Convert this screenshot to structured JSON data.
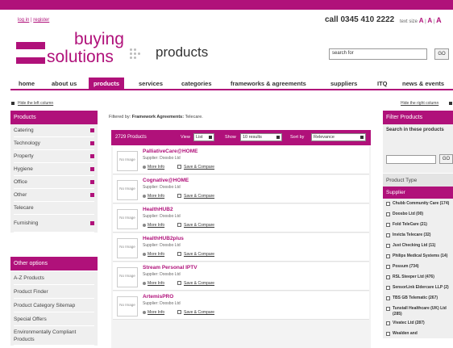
{
  "header": {
    "login_link": "log in",
    "register_link": "register",
    "call": "call 0345 410 2222",
    "text_size_label": "text size",
    "text_size_options": [
      "A",
      "A",
      "A"
    ],
    "logo_line1": "buying",
    "logo_line2": "solutions",
    "section_title": "products",
    "search_value": "search for",
    "search_button": "GO"
  },
  "nav": {
    "items": [
      "home",
      "about us",
      "products",
      "services",
      "categories",
      "frameworks & agreements",
      "suppliers",
      "ITQ",
      "news & events"
    ],
    "active": "products"
  },
  "hide_left_label": "Hide the left column",
  "hide_right_label": "Hide the right column",
  "left": {
    "products_title": "Products",
    "categories": [
      "Catering",
      "Technology",
      "Property",
      "Hygiene",
      "Office",
      "Other",
      "Telecare",
      "Furnishing"
    ],
    "other_options_title": "Other options",
    "other_options": [
      "A-Z Products",
      "Product Finder",
      "Product Category Sitemap",
      "Special Offers",
      "Environmentally Compliant Products"
    ]
  },
  "filter": {
    "prefix": "Filtered by:",
    "label": "Framework Agreements:",
    "value": "Telecare."
  },
  "results_header": {
    "count": "2729 Products",
    "view_label": "View",
    "view_value": "List",
    "show_label": "Show",
    "show_value": "10 results",
    "sort_label": "Sort by",
    "sort_value": "Relevance"
  },
  "no_image_text": "No Image",
  "more_info_label": "More Info",
  "save_compare_label": "Save & Compare",
  "products": [
    {
      "name": "PalliativeCare@HOME",
      "supplier": "Supplier: Doosbo Ltd"
    },
    {
      "name": "Cognative@HOME",
      "supplier": "Supplier: Doosbo Ltd"
    },
    {
      "name": "HealthHUB2",
      "supplier": "Supplier: Doosbo Ltd"
    },
    {
      "name": "HealthHUB2plus",
      "supplier": "Supplier: Doosbo Ltd"
    },
    {
      "name": "Stream Personal IPTV",
      "supplier": "Supplier: Doosbo Ltd"
    },
    {
      "name": "ArtemisPRO",
      "supplier": "Supplier: Doosbo Ltd"
    }
  ],
  "right": {
    "filter_title": "Filter Products",
    "search_in_label": "Search in these products",
    "search_go": "GO",
    "product_type_label": "Product Type",
    "supplier_label": "Supplier",
    "suppliers": [
      "Chubb Community Care (174)",
      "Doosbo Ltd (00)",
      "Fold TeleCare (21)",
      "Invicta Telecare (32)",
      "Just Checking Ltd (11)",
      "Philips Medical Systems (14)",
      "Possum (734)",
      "RSL Steeper Ltd (476)",
      "SensorLink Eldercare LLP (2)",
      "TBS GB Telematic (267)",
      "Tunstall Healthcare (UK) Ltd (285)",
      "Vivatec Ltd (287)",
      "Wealden and"
    ]
  },
  "colors": {
    "brand": "#b0117a",
    "panel_bg": "#efefef"
  }
}
